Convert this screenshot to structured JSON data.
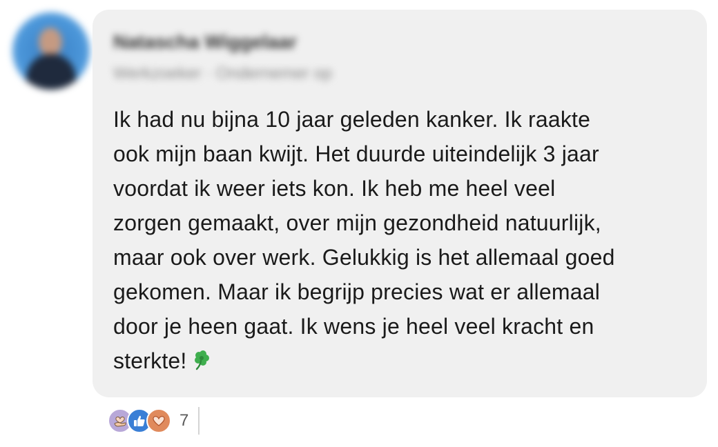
{
  "author": {
    "name": "Natascha Wiggelaar",
    "subtitle": "Werkzoeker · Ondernemer op"
  },
  "comment": {
    "lines": [
      "Ik had nu bijna 10 jaar geleden kanker. Ik raakte",
      "ook mijn baan kwijt. Het duurde uiteindelijk 3 jaar",
      "voordat ik weer iets kon. Ik heb me heel veel",
      "zorgen gemaakt, over mijn gezondheid natuurlijk,",
      "maar ook over werk. Gelukkig is het allemaal goed",
      "gekomen. Maar ik begrijp precies wat er allemaal",
      "door je heen gaat. Ik wens je heel veel kracht en",
      "sterkte!"
    ],
    "emoji": "clover-icon"
  },
  "reactions": {
    "icons": [
      "support-icon",
      "like-icon",
      "love-icon"
    ],
    "count": "7"
  },
  "colors": {
    "bubble": "#f0f0f0",
    "like": "#3a7fd6",
    "love": "#e08a5c",
    "support": "#b8a8d8",
    "clover": "#3fae4e"
  }
}
